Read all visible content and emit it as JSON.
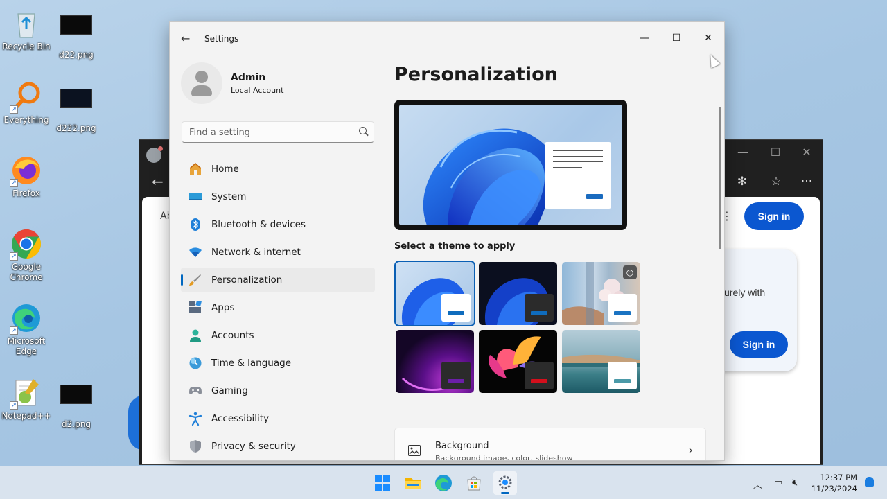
{
  "desktop": {
    "icons": [
      {
        "label": "Recycle Bin",
        "icon": "recycle-bin-icon"
      },
      {
        "label": "d22.png",
        "icon": "image-file-icon"
      },
      {
        "label": "Everything",
        "icon": "everything-search-icon"
      },
      {
        "label": "d222.png",
        "icon": "image-file-icon"
      },
      {
        "label": "Firefox",
        "icon": "firefox-icon"
      },
      {
        "label": "Google Chrome",
        "icon": "chrome-icon"
      },
      {
        "label": "Microsoft Edge",
        "icon": "edge-icon"
      },
      {
        "label": "Notepad++",
        "icon": "notepad-plus-plus-icon"
      },
      {
        "label": "d2.png",
        "icon": "image-file-icon"
      }
    ]
  },
  "browser": {
    "partial_text": "Ab",
    "sign_in_top": "Sign in",
    "card_text": "urely with",
    "sign_in_card": "Sign in",
    "accent": "#0b57d0"
  },
  "settings": {
    "title": "Settings",
    "window_controls": {
      "minimize": "—",
      "maximize": "☐",
      "close": "✕"
    },
    "user": {
      "name": "Admin",
      "account_type": "Local Account"
    },
    "search": {
      "placeholder": "Find a setting",
      "value": ""
    },
    "nav": [
      {
        "label": "Home",
        "icon": "home-icon"
      },
      {
        "label": "System",
        "icon": "system-display-icon"
      },
      {
        "label": "Bluetooth & devices",
        "icon": "bluetooth-icon"
      },
      {
        "label": "Network & internet",
        "icon": "wifi-icon"
      },
      {
        "label": "Personalization",
        "icon": "paintbrush-icon",
        "active": true
      },
      {
        "label": "Apps",
        "icon": "apps-icon"
      },
      {
        "label": "Accounts",
        "icon": "accounts-icon"
      },
      {
        "label": "Time & language",
        "icon": "clock-globe-icon"
      },
      {
        "label": "Gaming",
        "icon": "gamepad-icon"
      },
      {
        "label": "Accessibility",
        "icon": "accessibility-icon"
      },
      {
        "label": "Privacy & security",
        "icon": "shield-icon"
      }
    ],
    "page_title": "Personalization",
    "theme_section_label": "Select a theme to apply",
    "themes": [
      {
        "name": "windows-light",
        "selected": true,
        "accent": "#0f6cbd"
      },
      {
        "name": "windows-dark",
        "selected": false,
        "accent": "#0f6cbd"
      },
      {
        "name": "glow-flowers",
        "selected": false,
        "accent": "#1a73c2"
      },
      {
        "name": "captured-motion-purple",
        "selected": false,
        "accent": "#6b1fa8"
      },
      {
        "name": "flow-red",
        "selected": false,
        "accent": "#d40f1c"
      },
      {
        "name": "sunrise-lake",
        "selected": false,
        "accent": "#4b9aa8"
      }
    ],
    "background_row": {
      "title": "Background",
      "subtitle": "Background image, color, slideshow"
    }
  },
  "taskbar": {
    "apps": [
      "start-icon",
      "file-explorer-icon",
      "edge-icon",
      "microsoft-store-icon",
      "settings-icon"
    ],
    "active_app": "settings-icon",
    "time": "12:37 PM",
    "date": "11/23/2024"
  }
}
